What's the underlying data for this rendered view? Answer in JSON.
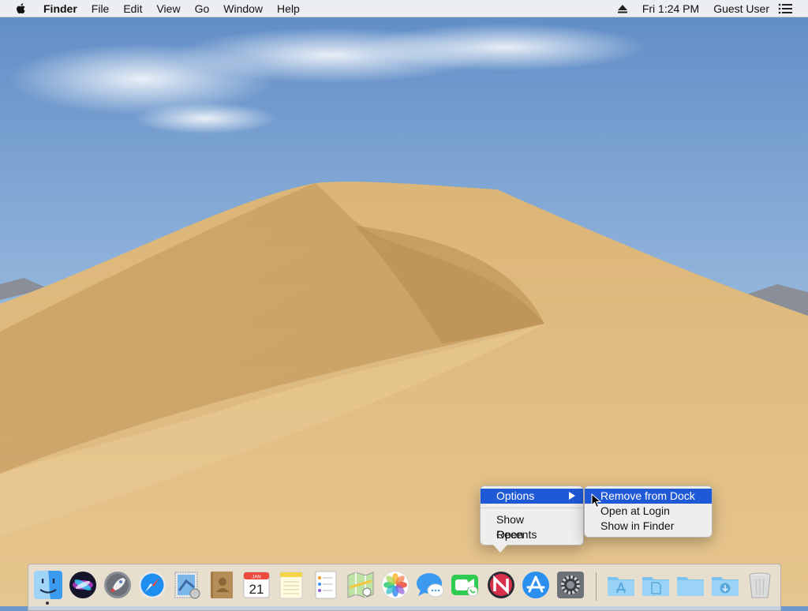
{
  "menubar": {
    "apple_icon": "apple-logo-icon",
    "app_name": "Finder",
    "menus": [
      "File",
      "Edit",
      "View",
      "Go",
      "Window",
      "Help"
    ],
    "eject_icon": "eject-icon",
    "clock": "Fri 1:24 PM",
    "user": "Guest User",
    "list_icon": "list-icon"
  },
  "dock": {
    "apps": [
      {
        "name": "Finder",
        "icon": "finder-icon",
        "running": true
      },
      {
        "name": "Siri",
        "icon": "siri-icon"
      },
      {
        "name": "Launchpad",
        "icon": "launchpad-rocket-icon"
      },
      {
        "name": "Safari",
        "icon": "safari-compass-icon"
      },
      {
        "name": "Mail",
        "icon": "mail-stamp-icon"
      },
      {
        "name": "Contacts",
        "icon": "contacts-book-icon"
      },
      {
        "name": "Calendar",
        "icon": "calendar-icon",
        "month": "JAN",
        "day": "21"
      },
      {
        "name": "Notes",
        "icon": "notes-icon"
      },
      {
        "name": "Reminders",
        "icon": "reminders-icon"
      },
      {
        "name": "Maps",
        "icon": "maps-icon"
      },
      {
        "name": "Photos",
        "icon": "photos-icon"
      },
      {
        "name": "Messages",
        "icon": "messages-icon"
      },
      {
        "name": "FaceTime",
        "icon": "facetime-icon"
      },
      {
        "name": "News",
        "icon": "news-icon"
      },
      {
        "name": "App Store",
        "icon": "app-store-icon"
      },
      {
        "name": "System Preferences",
        "icon": "system-preferences-gear-icon"
      }
    ],
    "folders": [
      {
        "name": "Applications",
        "icon": "applications-folder-icon"
      },
      {
        "name": "Documents",
        "icon": "documents-folder-icon"
      },
      {
        "name": "Desktop",
        "icon": "desktop-folder-icon"
      },
      {
        "name": "Downloads",
        "icon": "downloads-folder-icon"
      },
      {
        "name": "Trash",
        "icon": "trash-icon"
      }
    ]
  },
  "context_menu": {
    "items": [
      "Options",
      "Show Recents",
      "Open"
    ],
    "options_arrow_icon": "submenu-arrow-icon"
  },
  "submenu": {
    "items": [
      "Remove from Dock",
      "Open at Login",
      "Show in Finder"
    ]
  },
  "colors": {
    "selection": "#1f59d6",
    "sky": "#6f97c9",
    "sand": "#d7b274"
  }
}
